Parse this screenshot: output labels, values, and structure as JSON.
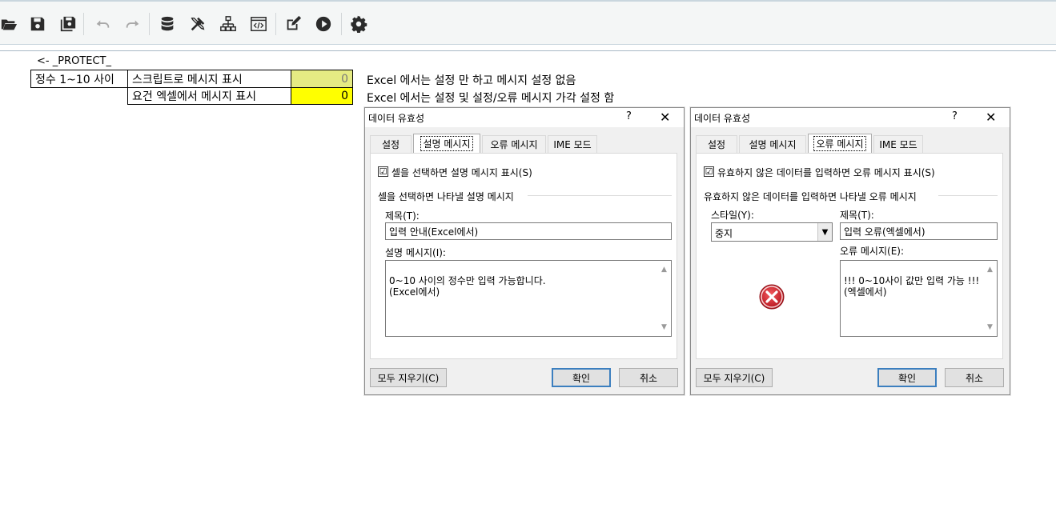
{
  "toolbar": {
    "icons": [
      "open-folder-icon",
      "save-icon",
      "save-all-icon",
      "undo-icon",
      "redo-icon",
      "database-icon",
      "tools-icon",
      "hierarchy-icon",
      "code-window-icon",
      "edit-icon",
      "run-icon",
      "settings-icon"
    ],
    "accent": "#2b2b2b"
  },
  "sheet": {
    "protect_label": "<- _PROTECT_",
    "row_header": "정수 1~10 사이",
    "row1_label": "스크립트로 메시지 표시",
    "row1_value": "0",
    "row2_label": "요건 엑셀에서 메시지 표시",
    "row2_value": "0",
    "row1_color": "#e5eb83",
    "row2_color": "#ffff00",
    "note1": "Excel 에서는 설정 만 하고 메시지 설정 없음",
    "note2": "Excel 에서는 설정 및 설정/오류 메시지 가각 설정 함"
  },
  "dialog1": {
    "title": "데이터 유효성",
    "help": "?",
    "close": "✕",
    "tabs": [
      "설정",
      "설명 메시지",
      "오류 메시지",
      "IME 모드"
    ],
    "active_tab": "설명 메시지",
    "checkbox_checked": "☑",
    "checkbox_label": "셀을 선택하면 설명 메시지 표시(S)",
    "group_label": "셀을 선택하면 나타낼 설명 메시지",
    "title_label": "제목(T):",
    "title_value": "입력 안내(Excel에서)",
    "message_label": "설명 메시지(I):",
    "message_value": "0~10 사이의 정수만 입력 가능합니다.\n(Excel에서)",
    "clear_button": "모두 지우기(C)",
    "ok_button": "확인",
    "cancel_button": "취소"
  },
  "dialog2": {
    "title": "데이터 유효성",
    "help": "?",
    "close": "✕",
    "tabs": [
      "설정",
      "설명 메시지",
      "오류 메시지",
      "IME 모드"
    ],
    "active_tab": "오류 메시지",
    "checkbox_label": "유효하지 않은 데이터를 입력하면 오류 메시지 표시(S)",
    "group_label": "유효하지 않은 데이터를 입력하면 나타낼 오류 메시지",
    "style_label": "스타일(Y):",
    "style_value": "중지",
    "title_label": "제목(T):",
    "title_value": "입력 오류(엑셀에서)",
    "message_label": "오류 메시지(E):",
    "message_value": "!!! 0~10사이 값만 입력 가능 !!!\n(엑셀에서)",
    "clear_button": "모두 지우기(C)",
    "ok_button": "확인",
    "cancel_button": "취소",
    "stop_icon_color": "#d9252c"
  }
}
